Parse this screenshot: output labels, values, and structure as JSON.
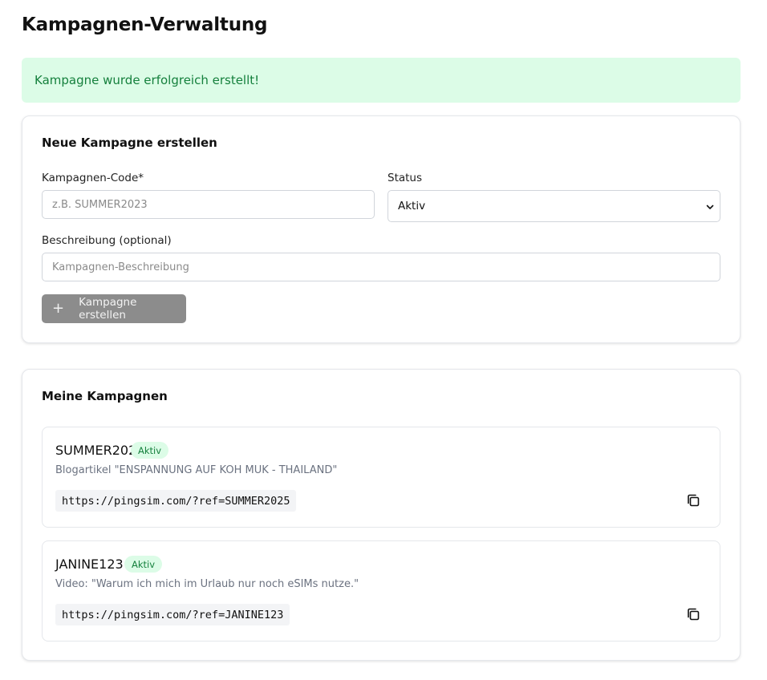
{
  "page": {
    "title": "Kampagnen-Verwaltung"
  },
  "alert": {
    "message": "Kampagne wurde erfolgreich erstellt!"
  },
  "create_form": {
    "title": "Neue Kampagne erstellen",
    "code_label": "Kampagnen-Code*",
    "code_placeholder": "z.B. SUMMER2023",
    "code_value": "",
    "status_label": "Status",
    "status_value": "Aktiv",
    "description_label": "Beschreibung (optional)",
    "description_placeholder": "Kampagnen-Beschreibung",
    "description_value": "",
    "submit_icon": "plus-icon",
    "submit_label": "Kampagne erstellen"
  },
  "campaigns_section": {
    "title": "Meine Kampagnen",
    "items": [
      {
        "code": "SUMMER2025",
        "status": "Aktiv",
        "description": "Blogartikel \"ENSPANNUNG AUF KOH MUK - THAILAND\"",
        "url": "https://pingsim.com/?ref=SUMMER2025",
        "copy_icon": "copy-icon"
      },
      {
        "code": "JANINE123",
        "status": "Aktiv",
        "description": "Video: \"Warum ich mich im Urlaub nur noch eSIMs nutze.\"",
        "url": "https://pingsim.com/?ref=JANINE123",
        "copy_icon": "copy-icon"
      }
    ]
  },
  "colors": {
    "success_bg": "#dcfce7",
    "success_text": "#15803d",
    "button_disabled": "#8c8c8c",
    "border": "#e5e7eb"
  }
}
